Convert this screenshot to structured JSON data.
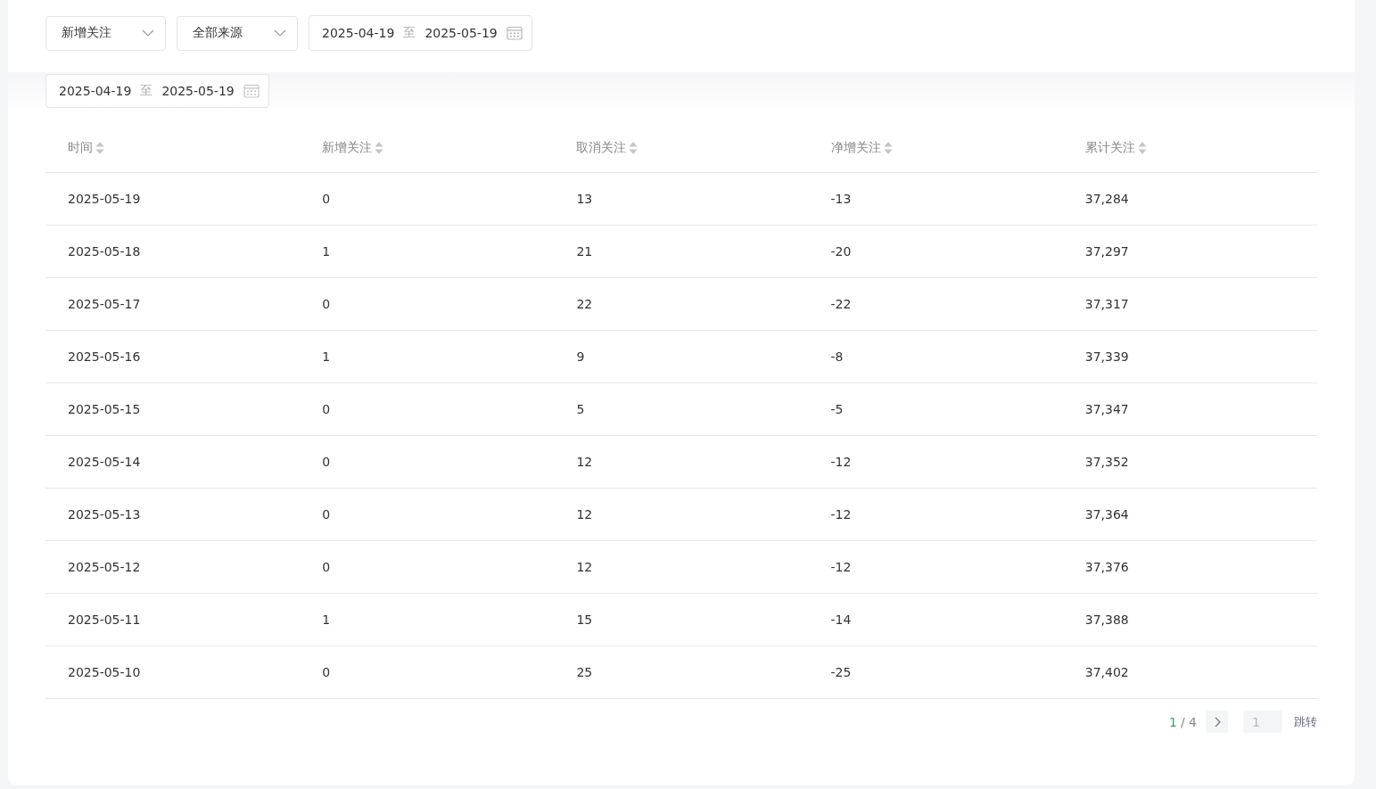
{
  "filters": {
    "metric_select": {
      "value": "新增关注"
    },
    "source_select": {
      "value": "全部来源"
    },
    "date_range": {
      "start": "2025-04-19",
      "separator": "至",
      "end": "2025-05-19"
    }
  },
  "scrolled_date_range": {
    "start": "2025-04-19",
    "separator": "至",
    "end": "2025-05-19"
  },
  "table": {
    "columns": [
      "时间",
      "新增关注",
      "取消关注",
      "净增关注",
      "累计关注"
    ],
    "rows": [
      [
        "2025-05-19",
        "0",
        "13",
        "-13",
        "37,284"
      ],
      [
        "2025-05-18",
        "1",
        "21",
        "-20",
        "37,297"
      ],
      [
        "2025-05-17",
        "0",
        "22",
        "-22",
        "37,317"
      ],
      [
        "2025-05-16",
        "1",
        "9",
        "-8",
        "37,339"
      ],
      [
        "2025-05-15",
        "0",
        "5",
        "-5",
        "37,347"
      ],
      [
        "2025-05-14",
        "0",
        "12",
        "-12",
        "37,352"
      ],
      [
        "2025-05-13",
        "0",
        "12",
        "-12",
        "37,364"
      ],
      [
        "2025-05-12",
        "0",
        "12",
        "-12",
        "37,376"
      ],
      [
        "2025-05-11",
        "1",
        "15",
        "-14",
        "37,388"
      ],
      [
        "2025-05-10",
        "0",
        "25",
        "-25",
        "37,402"
      ]
    ]
  },
  "pagination": {
    "current": "1",
    "separator": "/",
    "total": "4",
    "page_input": {
      "placeholder": "1"
    },
    "jump_button": "跳转"
  }
}
